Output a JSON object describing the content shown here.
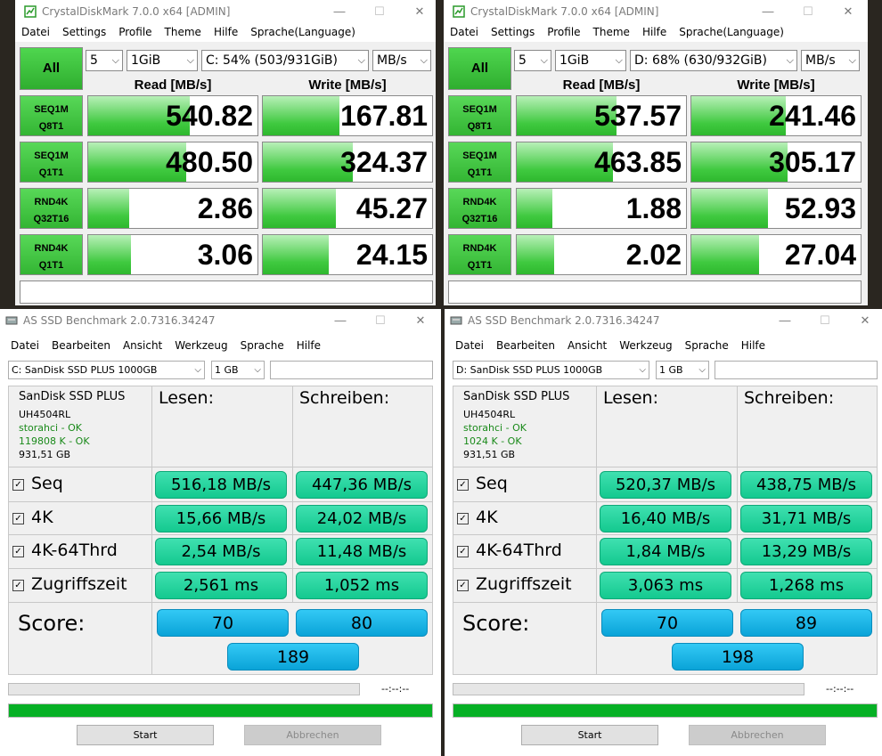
{
  "cdm_left": {
    "title": "CrystalDiskMark 7.0.0 x64 [ADMIN]",
    "menu": [
      "Datei",
      "Settings",
      "Profile",
      "Theme",
      "Hilfe",
      "Sprache(Language)"
    ],
    "all_label": "All",
    "count": "5",
    "size": "1GiB",
    "drive": "C: 54% (503/931GiB)",
    "unit": "MB/s",
    "read_header": "Read [MB/s]",
    "write_header": "Write [MB/s]",
    "tests": [
      {
        "l1": "SEQ1M",
        "l2": "Q8T1",
        "read": "540.82",
        "write": "167.81",
        "read_fill": 0.6,
        "write_fill": 0.45
      },
      {
        "l1": "SEQ1M",
        "l2": "Q1T1",
        "read": "480.50",
        "write": "324.37",
        "read_fill": 0.58,
        "write_fill": 0.53
      },
      {
        "l1": "RND4K",
        "l2": "Q32T16",
        "read": "2.86",
        "write": "45.27",
        "read_fill": 0.24,
        "write_fill": 0.43
      },
      {
        "l1": "RND4K",
        "l2": "Q1T1",
        "read": "3.06",
        "write": "24.15",
        "read_fill": 0.25,
        "write_fill": 0.39
      }
    ]
  },
  "cdm_right": {
    "title": "CrystalDiskMark 7.0.0 x64 [ADMIN]",
    "menu": [
      "Datei",
      "Settings",
      "Profile",
      "Theme",
      "Hilfe",
      "Sprache(Language)"
    ],
    "all_label": "All",
    "count": "5",
    "size": "1GiB",
    "drive": "D: 68% (630/932GiB)",
    "unit": "MB/s",
    "read_header": "Read [MB/s]",
    "write_header": "Write [MB/s]",
    "tests": [
      {
        "l1": "SEQ1M",
        "l2": "Q8T1",
        "read": "537.57",
        "write": "241.46",
        "read_fill": 0.59,
        "write_fill": 0.56
      },
      {
        "l1": "SEQ1M",
        "l2": "Q1T1",
        "read": "463.85",
        "write": "305.17",
        "read_fill": 0.57,
        "write_fill": 0.57
      },
      {
        "l1": "RND4K",
        "l2": "Q32T16",
        "read": "1.88",
        "write": "52.93",
        "read_fill": 0.21,
        "write_fill": 0.45
      },
      {
        "l1": "RND4K",
        "l2": "Q1T1",
        "read": "2.02",
        "write": "27.04",
        "read_fill": 0.22,
        "write_fill": 0.4
      }
    ]
  },
  "as_left": {
    "title": "AS SSD Benchmark 2.0.7316.34247",
    "menu": [
      "Datei",
      "Bearbeiten",
      "Ansicht",
      "Werkzeug",
      "Sprache",
      "Hilfe"
    ],
    "drive": "C: SanDisk SSD PLUS 1000GB",
    "size": "1 GB",
    "device": {
      "name": "SanDisk SSD PLUS",
      "fw": "UH4504RL",
      "driver": "storahci - OK",
      "align": "119808 K - OK",
      "capacity": "931,51 GB"
    },
    "read_header": "Lesen:",
    "write_header": "Schreiben:",
    "rows": [
      {
        "label": "Seq",
        "read": "516,18 MB/s",
        "write": "447,36 MB/s"
      },
      {
        "label": "4K",
        "read": "15,66 MB/s",
        "write": "24,02 MB/s"
      },
      {
        "label": "4K-64Thrd",
        "read": "2,54 MB/s",
        "write": "11,48 MB/s"
      },
      {
        "label": "Zugriffszeit",
        "read": "2,561 ms",
        "write": "1,052 ms"
      }
    ],
    "score_label": "Score:",
    "score_read": "70",
    "score_write": "80",
    "score_total": "189",
    "time": "--:--:--",
    "start_label": "Start",
    "abort_label": "Abbrechen"
  },
  "as_right": {
    "title": "AS SSD Benchmark 2.0.7316.34247",
    "menu": [
      "Datei",
      "Bearbeiten",
      "Ansicht",
      "Werkzeug",
      "Sprache",
      "Hilfe"
    ],
    "drive": "D: SanDisk SSD PLUS 1000GB",
    "size": "1 GB",
    "device": {
      "name": "SanDisk SSD PLUS",
      "fw": "UH4504RL",
      "driver": "storahci - OK",
      "align": "1024 K - OK",
      "capacity": "931,51 GB"
    },
    "read_header": "Lesen:",
    "write_header": "Schreiben:",
    "rows": [
      {
        "label": "Seq",
        "read": "520,37 MB/s",
        "write": "438,75 MB/s"
      },
      {
        "label": "4K",
        "read": "16,40 MB/s",
        "write": "31,71 MB/s"
      },
      {
        "label": "4K-64Thrd",
        "read": "1,84 MB/s",
        "write": "13,29 MB/s"
      },
      {
        "label": "Zugriffszeit",
        "read": "3,063 ms",
        "write": "1,268 ms"
      }
    ],
    "score_label": "Score:",
    "score_read": "70",
    "score_write": "89",
    "score_total": "198",
    "time": "--:--:--",
    "start_label": "Start",
    "abort_label": "Abbrechen"
  },
  "colors": {
    "cdm_green": "#33b533",
    "as_green_result": "#14c98f",
    "as_blue_score": "#0aa3d8",
    "progress_green": "#06b025"
  }
}
